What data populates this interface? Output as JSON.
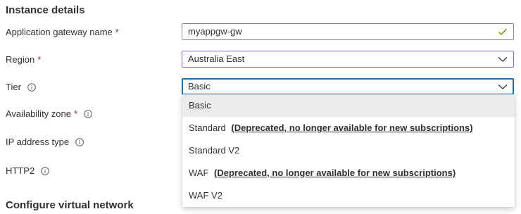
{
  "section": {
    "instance_details": "Instance details",
    "configure_vnet": "Configure virtual network"
  },
  "fields": {
    "gateway_name": {
      "label": "Application gateway name",
      "required_marker": "*",
      "value": "myappgw-gw",
      "status_icon": "check-icon"
    },
    "region": {
      "label": "Region",
      "required_marker": "*",
      "value": "Australia East"
    },
    "tier": {
      "label": "Tier",
      "value": "Basic"
    },
    "availability_zone": {
      "label": "Availability zone",
      "required_marker": "*"
    },
    "ip_address_type": {
      "label": "IP address type"
    },
    "http2": {
      "label": "HTTP2"
    }
  },
  "tier_dropdown": {
    "options": [
      {
        "name": "Basic",
        "note": ""
      },
      {
        "name": "Standard",
        "note": "(Deprecated, no longer available for new subscriptions)"
      },
      {
        "name": "Standard V2",
        "note": ""
      },
      {
        "name": "WAF",
        "note": "(Deprecated, no longer available for new subscriptions)"
      },
      {
        "name": "WAF V2",
        "note": ""
      }
    ],
    "selected_index": 0
  },
  "colors": {
    "required": "#a4262c",
    "focus_border": "#106ebe",
    "region_border": "#8661c5",
    "check": "#57a300",
    "selected_option_bg": "#edebe9"
  }
}
